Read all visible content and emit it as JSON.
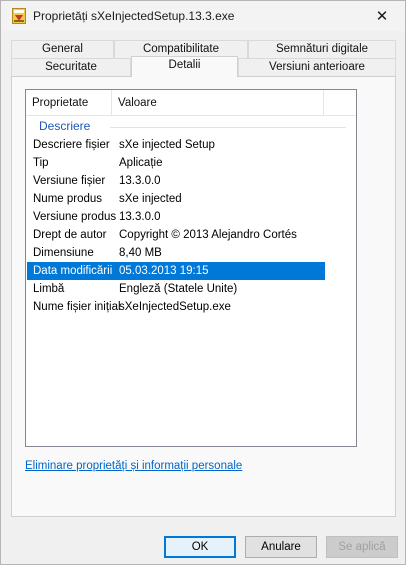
{
  "window": {
    "title": "Proprietăți sXeInjectedSetup.13.3.exe",
    "close_glyph": "✕",
    "app_icon": "setup-exe-icon"
  },
  "tabs": {
    "row1": [
      "General",
      "Compatibilitate",
      "Semnături digitale"
    ],
    "row2": [
      "Securitate",
      "Detalii",
      "Versiuni anterioare"
    ],
    "active": "Detalii"
  },
  "details": {
    "headers": {
      "property": "Proprietate",
      "value": "Valoare"
    },
    "group": "Descriere",
    "rows": [
      {
        "key": "Descriere fișier",
        "value": "sXe injected Setup"
      },
      {
        "key": "Tip",
        "value": "Aplicație"
      },
      {
        "key": "Versiune fișier",
        "value": "13.3.0.0"
      },
      {
        "key": "Nume produs",
        "value": "sXe injected"
      },
      {
        "key": "Versiune produs",
        "value": "13.3.0.0"
      },
      {
        "key": "Drept de autor",
        "value": "Copyright © 2013 Alejandro Cortés"
      },
      {
        "key": "Dimensiune",
        "value": "8,40 MB"
      },
      {
        "key": "Data modificării",
        "value": "05.03.2013 19:15"
      },
      {
        "key": "Limbă",
        "value": "Engleză (Statele Unite)"
      },
      {
        "key": "Nume fișier inițial",
        "value": "sXeInjectedSetup.exe"
      }
    ],
    "selected_key": "Data modificării",
    "remove_link": "Eliminare proprietăți și informații personale"
  },
  "buttons": {
    "ok": "OK",
    "cancel": "Anulare",
    "apply": "Se aplică"
  },
  "colors": {
    "selection": "#0078d7",
    "group_title": "#1e57b5",
    "link": "#0066cc"
  }
}
